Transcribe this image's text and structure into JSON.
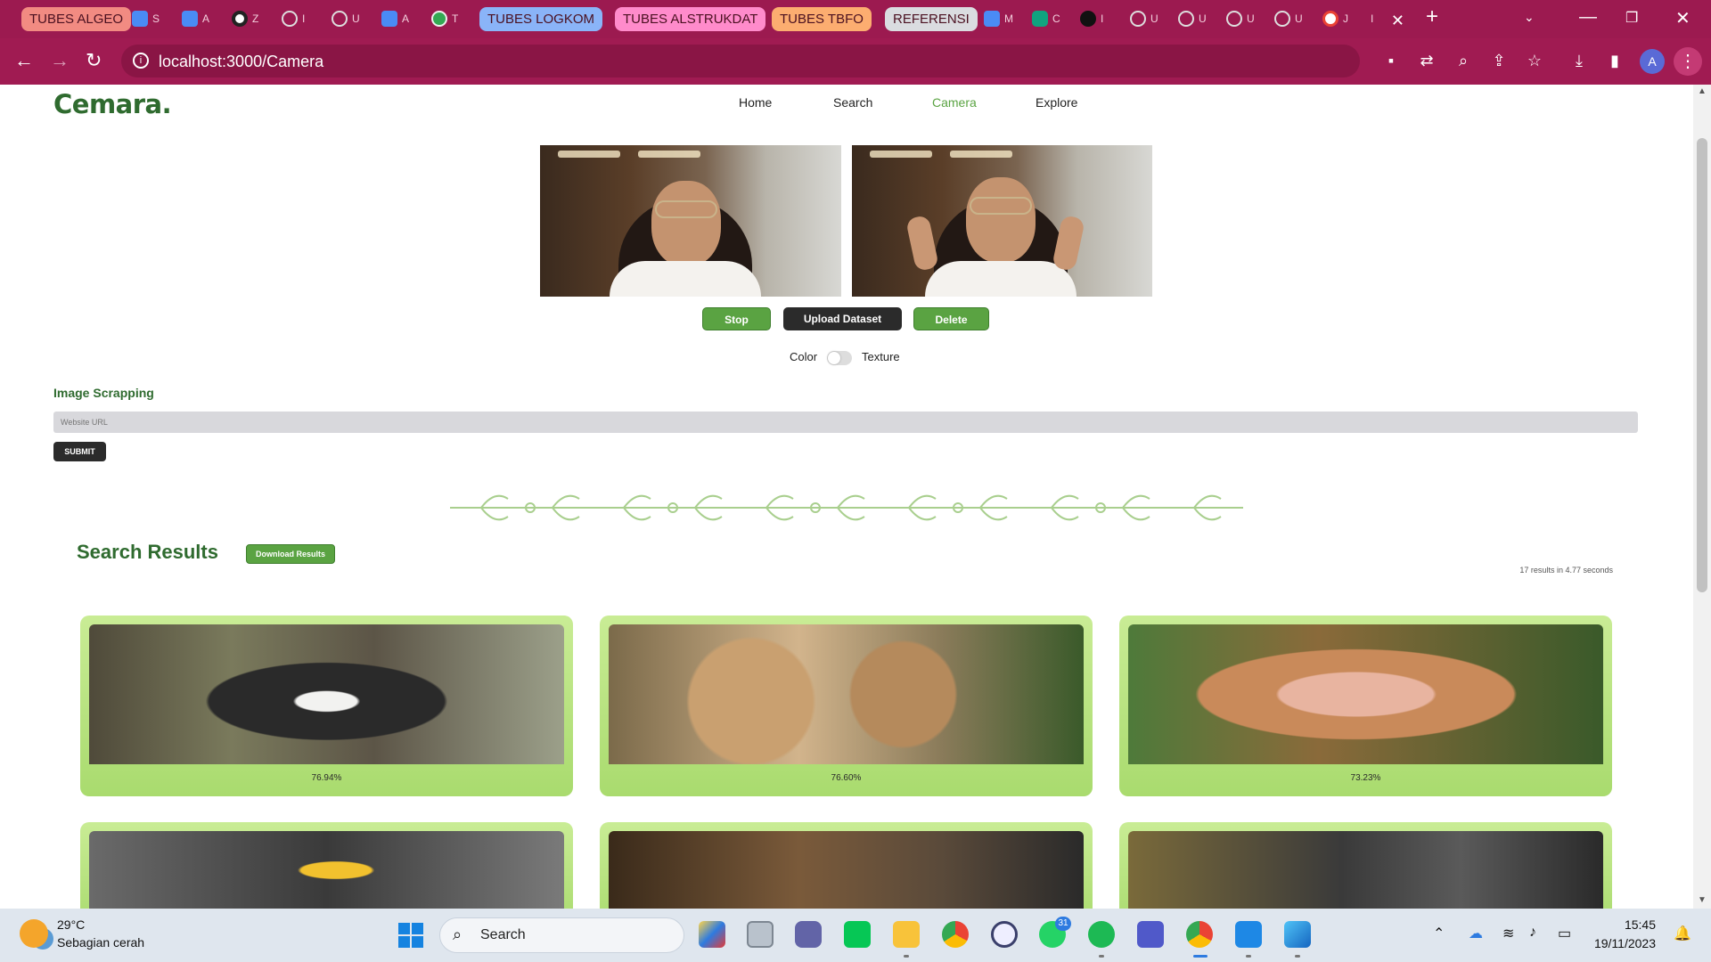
{
  "browser": {
    "tab_groups": [
      {
        "label": "TUBES ALGEO",
        "color": "#f28b82"
      },
      {
        "label": "TUBES LOGKOM",
        "color": "#8ab4f8"
      },
      {
        "label": "TUBES ALSTRUKDAT",
        "color": "#ff8bcb"
      },
      {
        "label": "TUBES TBFO",
        "color": "#fcad70"
      },
      {
        "label": "REFERENSI",
        "color": "#dadce0"
      }
    ],
    "mini_tabs": [
      "S",
      "A",
      "Z",
      "I",
      "U",
      "A",
      "T",
      "M",
      "C",
      "I",
      "U",
      "U",
      "U",
      "U",
      "J",
      "I"
    ],
    "url": "localhost:3000/Camera",
    "profile_initial": "A"
  },
  "app": {
    "logo": "Cemara.",
    "nav": [
      "Home",
      "Search",
      "Camera",
      "Explore"
    ],
    "active_nav": "Camera"
  },
  "camera": {
    "buttons": {
      "stop": "Stop",
      "upload": "Upload Dataset",
      "delete": "Delete"
    },
    "toggle": {
      "left": "Color",
      "right": "Texture",
      "state": "off"
    }
  },
  "scraping": {
    "title": "Image Scrapping",
    "placeholder": "Website URL",
    "submit": "SUBMIT"
  },
  "results": {
    "title": "Search Results",
    "download": "Download Results",
    "count_text": "17 results in 4.77 seconds",
    "cards": [
      {
        "score": "76.94%"
      },
      {
        "score": "76.60%"
      },
      {
        "score": "73.23%"
      }
    ]
  },
  "taskbar": {
    "weather_temp": "29°C",
    "weather_desc": "Sebagian cerah",
    "search_label": "Search",
    "whatsapp_badge": "31",
    "time": "15:45",
    "date": "19/11/2023"
  },
  "colors": {
    "chrome": "#9c1a50",
    "brand_green": "#2f6b2f",
    "accent_green": "#5aa342"
  }
}
